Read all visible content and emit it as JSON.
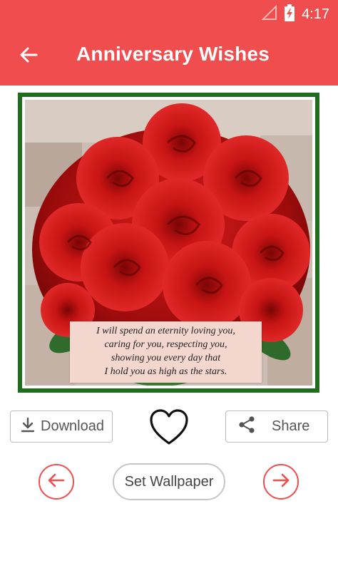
{
  "status_bar": {
    "time": "4:17",
    "icons": [
      "signal-icon",
      "battery-charging-icon"
    ]
  },
  "app_bar": {
    "title": "Anniversary Wishes",
    "back_icon": "back-arrow-icon",
    "color": "#f04e4e"
  },
  "card": {
    "frame_color": "#1e6e1e",
    "quote_lines": [
      "I will spend an eternity loving you,",
      "caring for you, respecting you,",
      "showing you every day that",
      "I hold you as high as the stars."
    ]
  },
  "actions": {
    "download_label": "Download",
    "share_label": "Share",
    "favorite_icon": "heart-outline-icon",
    "set_wallpaper_label": "Set Wallpaper",
    "prev_icon": "arrow-left-icon",
    "next_icon": "arrow-right-icon"
  }
}
